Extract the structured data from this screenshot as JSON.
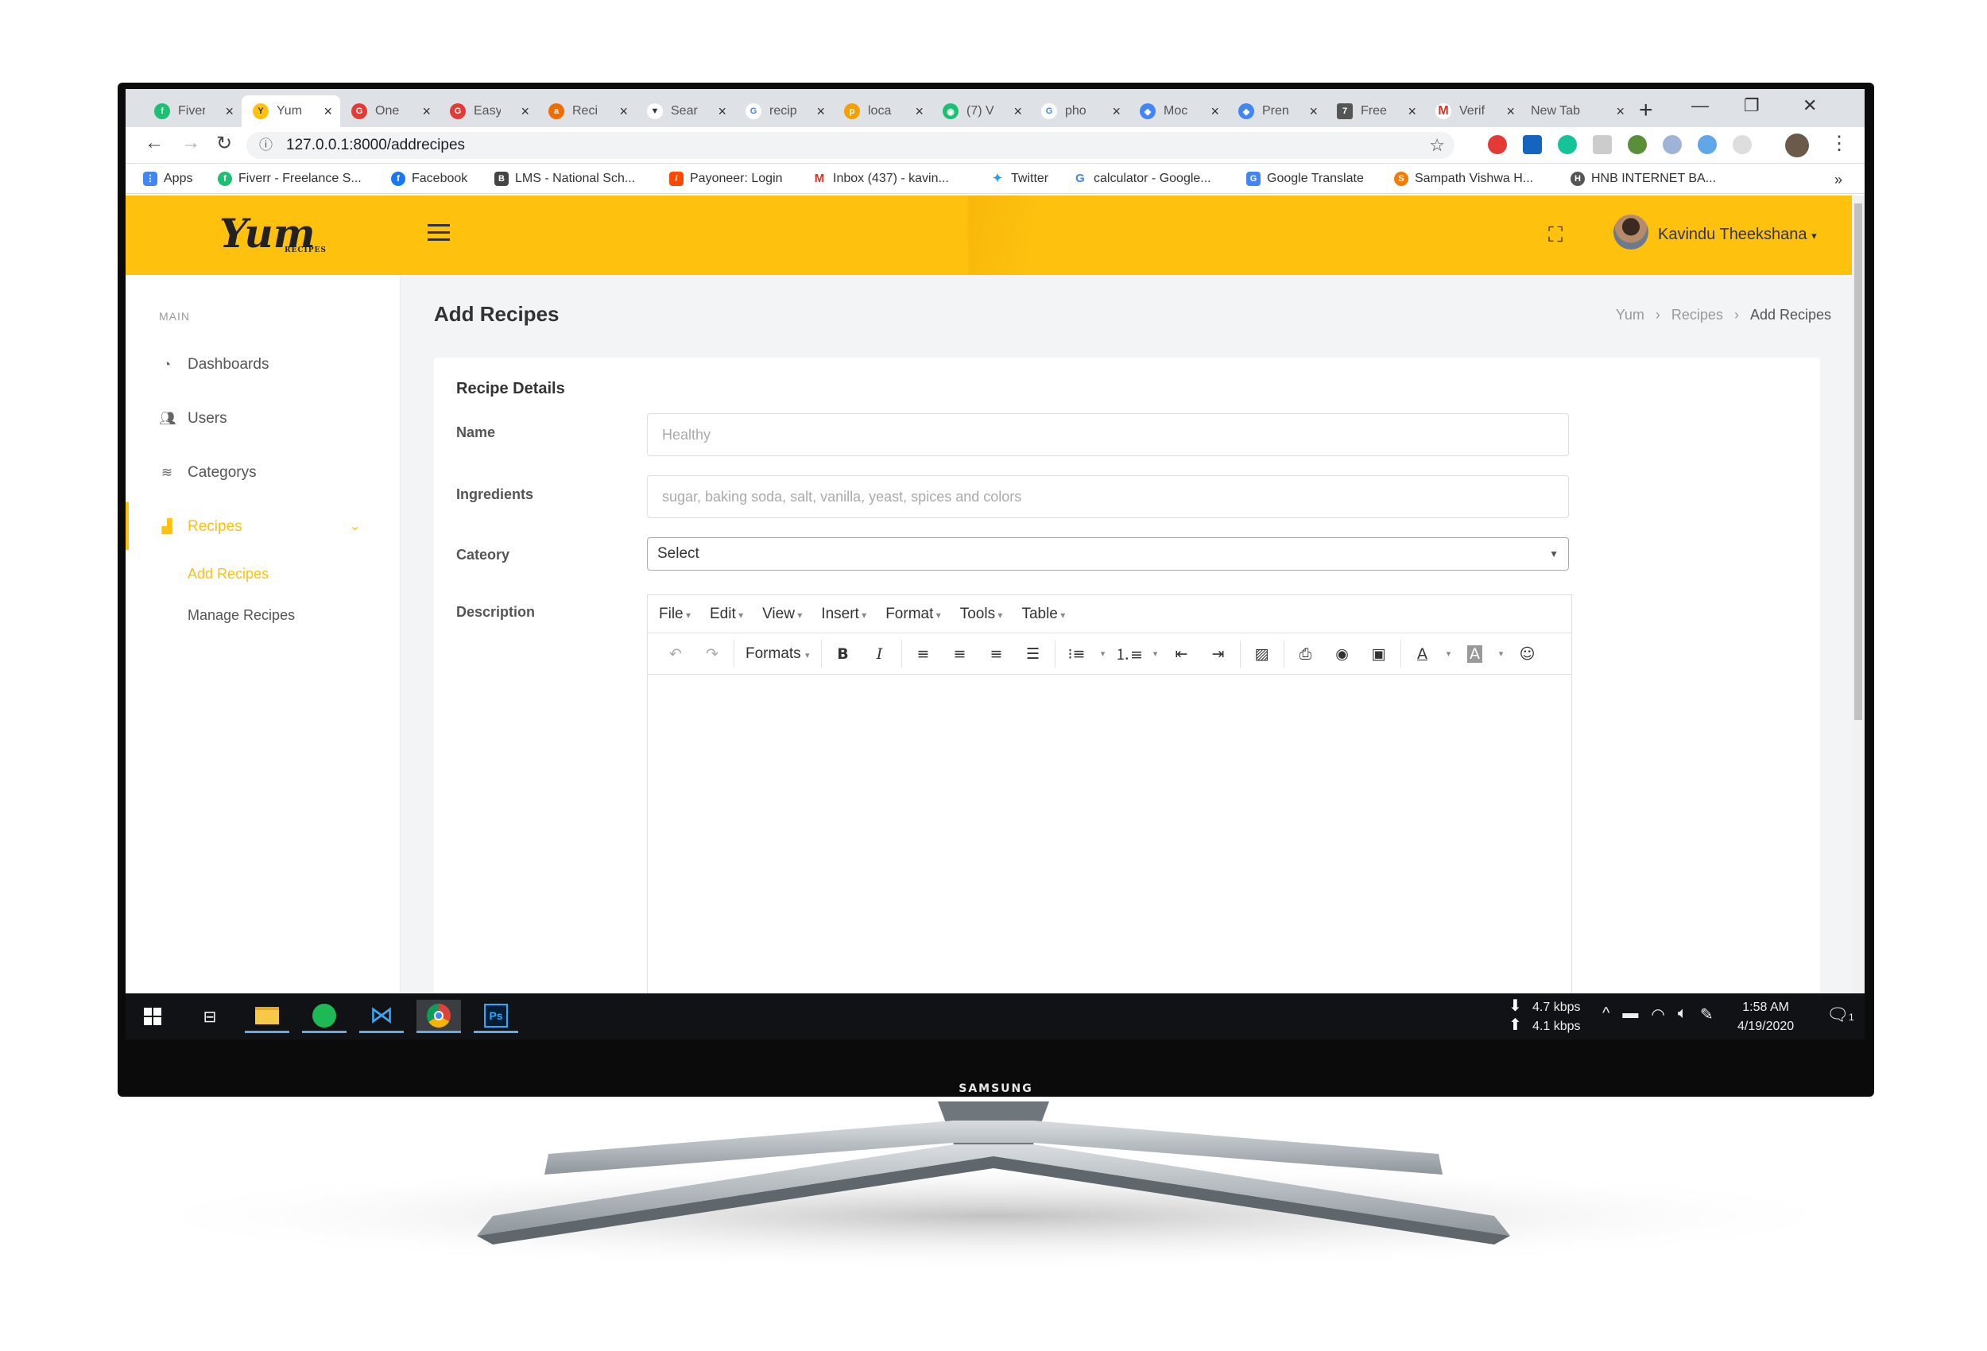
{
  "monitor": {
    "brand": "SAMSUNG"
  },
  "browser": {
    "tabs": [
      {
        "label": "Fiver",
        "color": "#1dbf73"
      },
      {
        "label": "Yum",
        "color": "#fdc10e"
      },
      {
        "label": "One",
        "color": "#e53935"
      },
      {
        "label": "Easy",
        "color": "#e53935"
      },
      {
        "label": "Reci",
        "color": "#ef6c00"
      },
      {
        "label": "Sear",
        "color": "#333"
      },
      {
        "label": "recip",
        "color": "#4285f4"
      },
      {
        "label": "loca",
        "color": "#f4a000"
      },
      {
        "label": "(7) V",
        "color": "#1dbf73"
      },
      {
        "label": "pho",
        "color": "#4285f4"
      },
      {
        "label": "Moc",
        "color": "#4285f4"
      },
      {
        "label": "Pren",
        "color": "#4285f4"
      },
      {
        "label": "Free",
        "color": "#555"
      },
      {
        "label": "Verif",
        "color": "#d93025"
      },
      {
        "label": "New Tab",
        "color": ""
      }
    ],
    "url": "127.0.0.1:8000/addrecipes",
    "bookmarks": [
      {
        "label": "Apps",
        "color": "#4285f4"
      },
      {
        "label": "Fiverr - Freelance S...",
        "color": "#1dbf73"
      },
      {
        "label": "Facebook",
        "color": "#1877f2"
      },
      {
        "label": "LMS - National Sch...",
        "color": "#444"
      },
      {
        "label": "Payoneer: Login",
        "color": "#ff4800"
      },
      {
        "label": "Inbox (437) - kavin...",
        "color": "#d93025"
      },
      {
        "label": "Twitter",
        "color": "#1da1f2"
      },
      {
        "label": "calculator - Google...",
        "color": "#4285f4"
      },
      {
        "label": "Google Translate",
        "color": "#4285f4"
      },
      {
        "label": "Sampath Vishwa H...",
        "color": "#f57c00"
      },
      {
        "label": "HNB INTERNET BA...",
        "color": "#555"
      }
    ]
  },
  "app": {
    "logo": "Yum",
    "logo_sub": "RECIPES",
    "user": "Kavindu Theekshana",
    "accent": "#fdc10e"
  },
  "sidebar": {
    "heading": "MAIN",
    "items": [
      {
        "label": "Dashboards",
        "icon": "gauge-icon"
      },
      {
        "label": "Users",
        "icon": "users-icon"
      },
      {
        "label": "Categorys",
        "icon": "layers-icon"
      },
      {
        "label": "Recipes",
        "icon": "chart-icon"
      }
    ],
    "sub_items": [
      "Add Recipes",
      "Manage Recipes"
    ]
  },
  "page": {
    "title": "Add Recipes",
    "breadcrumb": [
      "Yum",
      "Recipes",
      "Add Recipes"
    ]
  },
  "form": {
    "title": "Recipe Details",
    "name_label": "Name",
    "name_placeholder": "Healthy",
    "ingredients_label": "Ingredients",
    "ingredients_placeholder": "sugar, baking soda, salt, vanilla, yeast, spices and colors",
    "category_label": "Cateory",
    "category_value": "Select",
    "description_label": "Description",
    "editor_menu": [
      "File",
      "Edit",
      "View",
      "Insert",
      "Format",
      "Tools",
      "Table"
    ],
    "formats_label": "Formats"
  },
  "taskbar": {
    "download": "4.7 kbps",
    "upload": "4.1 kbps",
    "time": "1:58 AM",
    "date": "4/19/2020",
    "notifications": "1"
  }
}
